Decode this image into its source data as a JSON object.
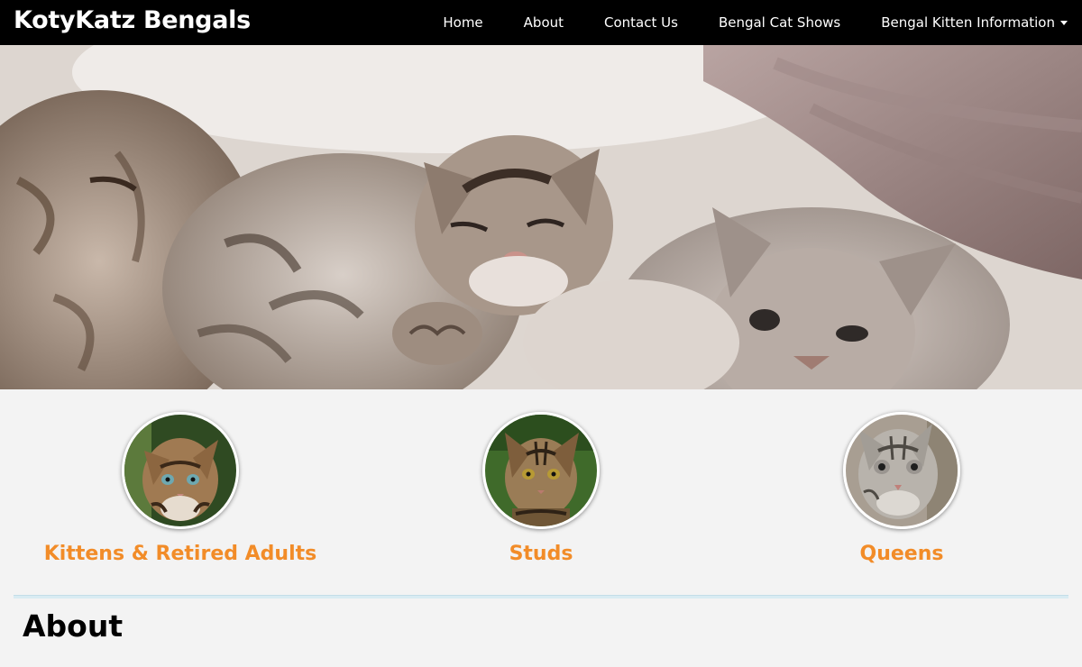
{
  "navbar": {
    "brand": "KotyKatz Bengals",
    "links": [
      "Home",
      "About",
      "Contact Us",
      "Bengal Cat Shows",
      "Bengal Kitten Information"
    ]
  },
  "cards": [
    {
      "title": "Kittens & Retired Adults"
    },
    {
      "title": "Studs"
    },
    {
      "title": "Queens"
    }
  ],
  "about": {
    "heading": "About"
  },
  "colors": {
    "nav_bg": "#000000",
    "page_bg": "#f3f3f3",
    "accent": "#f28c28",
    "divider": "#d9ebf2"
  }
}
